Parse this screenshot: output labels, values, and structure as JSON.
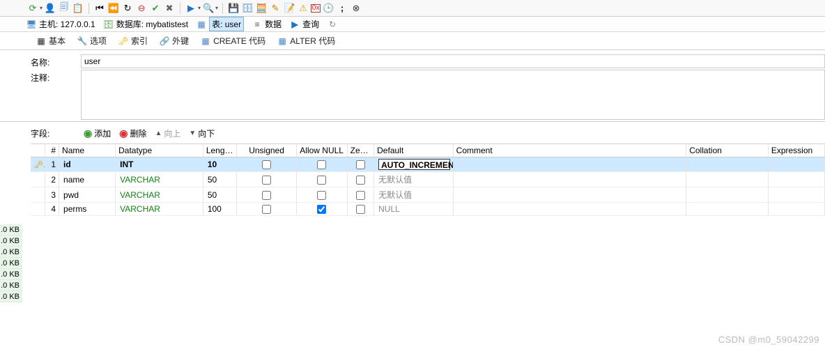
{
  "toolbar": {
    "icons": [
      "refresh",
      "user-add",
      "copy",
      "paste",
      "divider",
      "first",
      "prev",
      "prev-result",
      "stop",
      "ok",
      "cancel",
      "close",
      "divider",
      "play",
      "dropdown",
      "search",
      "dropdown",
      "divider",
      "save",
      "saveas",
      "search2",
      "edit",
      "note",
      "warn",
      "hex",
      "time",
      "semi",
      "cancel2"
    ]
  },
  "breadcrumb": {
    "host_label": "主机: 127.0.0.1",
    "db_label": "数据库: mybatistest",
    "table_label": "表: user",
    "data_label": "数据",
    "query_label": "查询"
  },
  "tabs": {
    "basic": "基本",
    "options": "选项",
    "index": "索引",
    "foreign": "外键",
    "create": "CREATE 代码",
    "alter": "ALTER 代码"
  },
  "form": {
    "name_label": "名称:",
    "name_value": "user",
    "comment_label": "注释:"
  },
  "fields_bar": {
    "label": "字段:",
    "add": "添加",
    "remove": "删除",
    "up": "向上",
    "down": "向下"
  },
  "grid": {
    "headers": {
      "num": "#",
      "name": "Name",
      "datatype": "Datatype",
      "length": "Lengt...",
      "unsigned": "Unsigned",
      "allow_null": "Allow NULL",
      "zerofill": "Zerofill",
      "default": "Default",
      "comment": "Comment",
      "collation": "Collation",
      "expression": "Expression"
    },
    "rows": [
      {
        "num": "1",
        "name": "id",
        "datatype": "INT",
        "length": "10",
        "unsigned": false,
        "allow_null": false,
        "zerofill": false,
        "default": "AUTO_INCREMENT",
        "default_muted": false,
        "selected": true,
        "key": true
      },
      {
        "num": "2",
        "name": "name",
        "datatype": "VARCHAR",
        "length": "50",
        "unsigned": false,
        "allow_null": false,
        "zerofill": false,
        "default": "无默认值",
        "default_muted": true,
        "selected": false,
        "key": false
      },
      {
        "num": "3",
        "name": "pwd",
        "datatype": "VARCHAR",
        "length": "50",
        "unsigned": false,
        "allow_null": false,
        "zerofill": false,
        "default": "无默认值",
        "default_muted": true,
        "selected": false,
        "key": false
      },
      {
        "num": "4",
        "name": "perms",
        "datatype": "VARCHAR",
        "length": "100",
        "unsigned": false,
        "allow_null": true,
        "zerofill": false,
        "default": "NULL",
        "default_muted": true,
        "selected": false,
        "key": false
      }
    ]
  },
  "left_strip": [
    ".0 KB",
    ".0 KB",
    ".0 KB",
    ".0 KB",
    ".0 KB",
    ".0 KB",
    ".0 KB"
  ],
  "watermark": "CSDN @m0_59042299"
}
